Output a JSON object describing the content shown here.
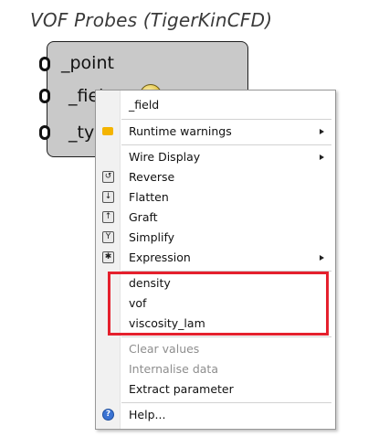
{
  "title": "VOF Probes (TigerKinCFD)",
  "component": {
    "params": [
      "_point",
      "_fiel",
      "_ty"
    ]
  },
  "menu": {
    "header": "_field",
    "items": [
      {
        "label": "Runtime warnings",
        "icon": "warning-icon",
        "submenu": true
      },
      {
        "label": "Wire Display",
        "icon": "",
        "submenu": true
      },
      {
        "label": "Reverse",
        "icon": "reverse-icon"
      },
      {
        "label": "Flatten",
        "icon": "flatten-icon"
      },
      {
        "label": "Graft",
        "icon": "graft-icon"
      },
      {
        "label": "Simplify",
        "icon": "simplify-icon"
      },
      {
        "label": "Expression",
        "icon": "expression-icon",
        "submenu": true
      }
    ],
    "options": [
      "density",
      "vof",
      "viscosity_lam"
    ],
    "actions": [
      {
        "label": "Clear values",
        "disabled": true
      },
      {
        "label": "Internalise data",
        "disabled": true
      },
      {
        "label": "Extract parameter",
        "disabled": false
      }
    ],
    "help": "Help..."
  },
  "colors": {
    "highlight": "#e5202d",
    "component_fill": "#c9c9c9"
  }
}
